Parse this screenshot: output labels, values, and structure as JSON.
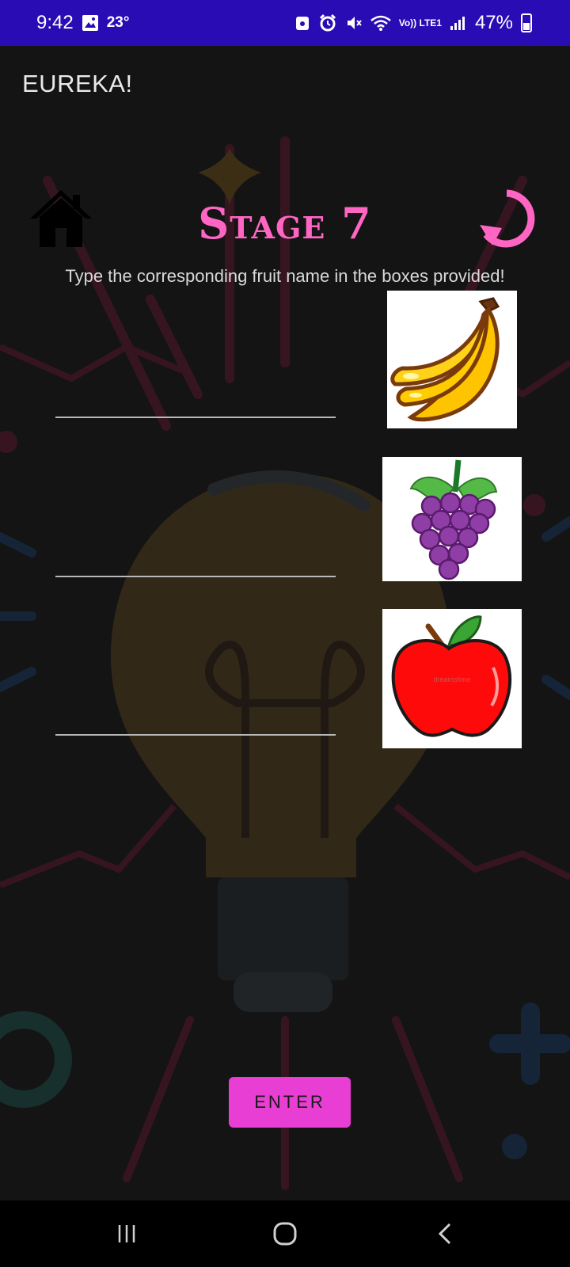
{
  "status_bar": {
    "time": "9:42",
    "temperature": "23°",
    "network": "Vo)) LTE1",
    "battery": "47%",
    "icons": [
      "gallery-icon",
      "lock-icon",
      "alarm-icon",
      "mute-icon",
      "wifi-icon",
      "signal-icon",
      "battery-icon"
    ]
  },
  "app_bar": {
    "title": "EUREKA!"
  },
  "game": {
    "stage_title": "Stage 7",
    "instructions": "Type the corresponding fruit name in the boxes provided!",
    "answers": [
      {
        "value": "",
        "image": "banana-image"
      },
      {
        "value": "",
        "image": "grapes-image"
      },
      {
        "value": "",
        "image": "apple-image"
      }
    ],
    "watermark": "dreamstime",
    "enter_label": "ENTER"
  },
  "colors": {
    "status_bar": "#2a0cb5",
    "background": "#141414",
    "accent_pink": "#ff66c4",
    "button": "#e83ed3"
  }
}
